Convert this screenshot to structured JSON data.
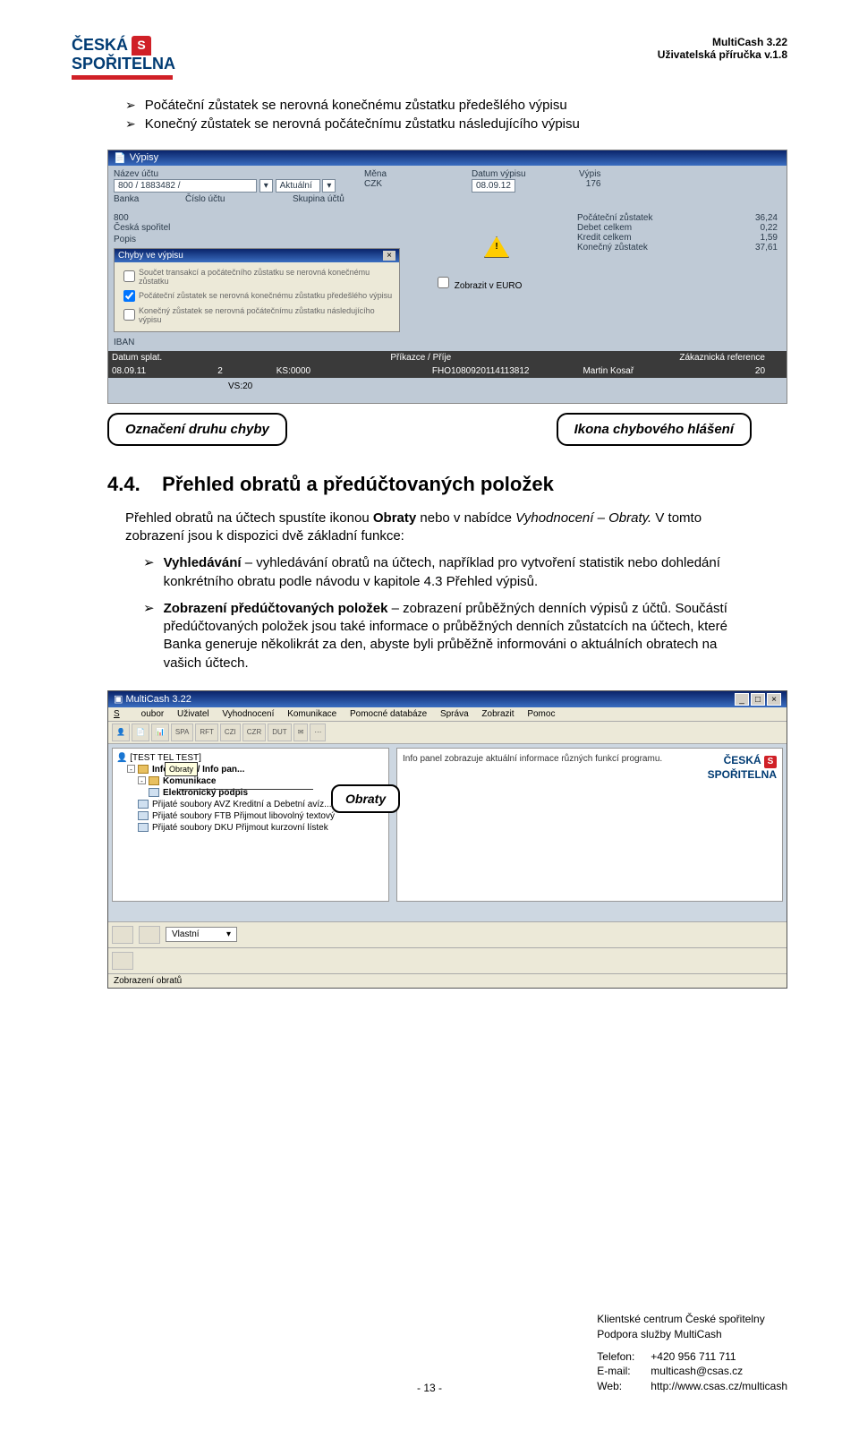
{
  "header": {
    "logo_top": "ČESKÁ",
    "logo_bottom": "SPOŘITELNA",
    "logo_s": "S",
    "right_line1": "MultiCash 3.22",
    "right_line2": "Uživatelská příručka v.1.8"
  },
  "top_bullets": [
    "Počáteční zůstatek se nerovná konečnému zůstatku předešlého výpisu",
    "Konečný zůstatek se nerovná počátečnímu zůstatku následujícího výpisu"
  ],
  "ss1": {
    "title": "Výpisy",
    "labels": {
      "nazev_uctu": "Název účtu",
      "mena": "Měna",
      "datum_vypisu": "Datum výpisu",
      "vypis": "Výpis",
      "banka": "Banka",
      "cislo_uctu": "Číslo účtu",
      "skupina": "Skupina účtů",
      "popis": "Popis",
      "iban": "IBAN",
      "poc_zust": "Počáteční zůstatek",
      "debet": "Debet celkem",
      "kredit": "Kredit celkem",
      "kon_zust": "Konečný zůstatek",
      "datum_splat": "Datum splat.",
      "prikazce": "Příkazce / Příje",
      "zak_ref": "Zákaznická reference"
    },
    "values": {
      "nazev": "800 / 1883482 /",
      "aktualni": "Aktuální",
      "mena": "CZK",
      "datum": "08.09.12",
      "vypis": "176",
      "banka": "800",
      "ceska": "Česká spořitel",
      "poc_zust": "36,24",
      "debet": "0,22",
      "kredit": "1,59",
      "kon_zust": "37,61",
      "datum_splat": "08.09.11",
      "mid1": "KS:0000",
      "ks2": "2",
      "vs": "VS:20",
      "fho": "FHO1080920114113812",
      "name": "Martin Kosař",
      "amt": "20",
      "zobrazit_euro": "Zobrazit v EURO"
    },
    "dialog": {
      "title": "Chyby ve výpisu",
      "opt1": "Součet transakcí a počátečního zůstatku se nerovná konečnému zůstatku",
      "opt2": "Počáteční zůstatek se nerovná konečnému zůstatku předešlého výpisu",
      "opt3": "Konečný zůstatek se nerovná počátečnímu zůstatku následujícího výpisu"
    }
  },
  "callouts": {
    "left": "Označení druhu chyby",
    "right": "Ikona chybového hlášení"
  },
  "section": {
    "num": "4.4.",
    "title": "Přehled obratů a předúčtovaných položek"
  },
  "para1_pre": "Přehled obratů na účtech spustíte ikonou ",
  "para1_b": "Obraty",
  "para1_mid": " nebo v nabídce ",
  "para1_i": "Vyhodnocení – Obraty.",
  "para1_post": " V tomto zobrazení jsou k dispozici dvě základní funkce:",
  "sub_bullets": [
    {
      "b": "Vyhledávání",
      "text": " – vyhledávání obratů na účtech, například pro vytvoření statistik nebo dohledání konkrétního obratu podle návodu v kapitole 4.3 Přehled výpisů."
    },
    {
      "b": "Zobrazení předúčtovaných položek",
      "text": " – zobrazení průběžných denních výpisů z účtů. Součástí předúčtovaných položek jsou také informace o průběžných denních zůstatcích na účtech, které Banka generuje několikrát za den, abyste byli průběžně informováni o aktuálních obratech na vašich účtech."
    }
  ],
  "ss2": {
    "title": "MultiCash 3.22",
    "menu": [
      "Soubor",
      "Uživatel",
      "Vyhodnocení",
      "Komunikace",
      "Pomocné databáze",
      "Správa",
      "Zobrazit",
      "Pomoc"
    ],
    "toolbar": [
      "",
      "",
      "",
      "SPA",
      "RFT",
      "CZI",
      "CZR",
      "DUT",
      "",
      "",
      ""
    ],
    "tree": {
      "root": "[TEST       TEL TEST]",
      "tooltip": "Obraty",
      "items": [
        {
          "lvl": 1,
          "box": "-",
          "icon": "fold",
          "label": "Informace / Info pan..."
        },
        {
          "lvl": 2,
          "box": "-",
          "icon": "fold",
          "label": "Komunikace"
        },
        {
          "lvl": 3,
          "box": "",
          "icon": "doc",
          "label": "Elektronický podpis"
        },
        {
          "lvl": 2,
          "box": "",
          "icon": "doc",
          "label": "Přijaté soubory AVZ Kreditní a Debetní avíz..."
        },
        {
          "lvl": 2,
          "box": "",
          "icon": "doc",
          "label": "Přijaté soubory FTB Přijmout libovolný textový"
        },
        {
          "lvl": 2,
          "box": "",
          "icon": "doc",
          "label": "Přijaté soubory DKU Přijmout kurzovní lístek"
        }
      ]
    },
    "info_text": "Info panel zobrazuje aktuální informace různých funkcí programu.",
    "info_logo_top": "ČESKÁ",
    "info_logo_bottom": "SPOŘITELNA",
    "obraty_label": "Obraty",
    "bottom_drop": "Vlastní",
    "status": "Zobrazení obratů"
  },
  "footer": {
    "l1": "Klientské centrum České spořitelny",
    "l2": "Podpora služby MultiCash",
    "tel_lab": "Telefon:",
    "tel": "+420 956 711 711",
    "em_lab": "E-mail:",
    "em": "multicash@csas.cz",
    "web_lab": "Web:",
    "web": "http://www.csas.cz/multicash",
    "page": "- 13 -"
  }
}
